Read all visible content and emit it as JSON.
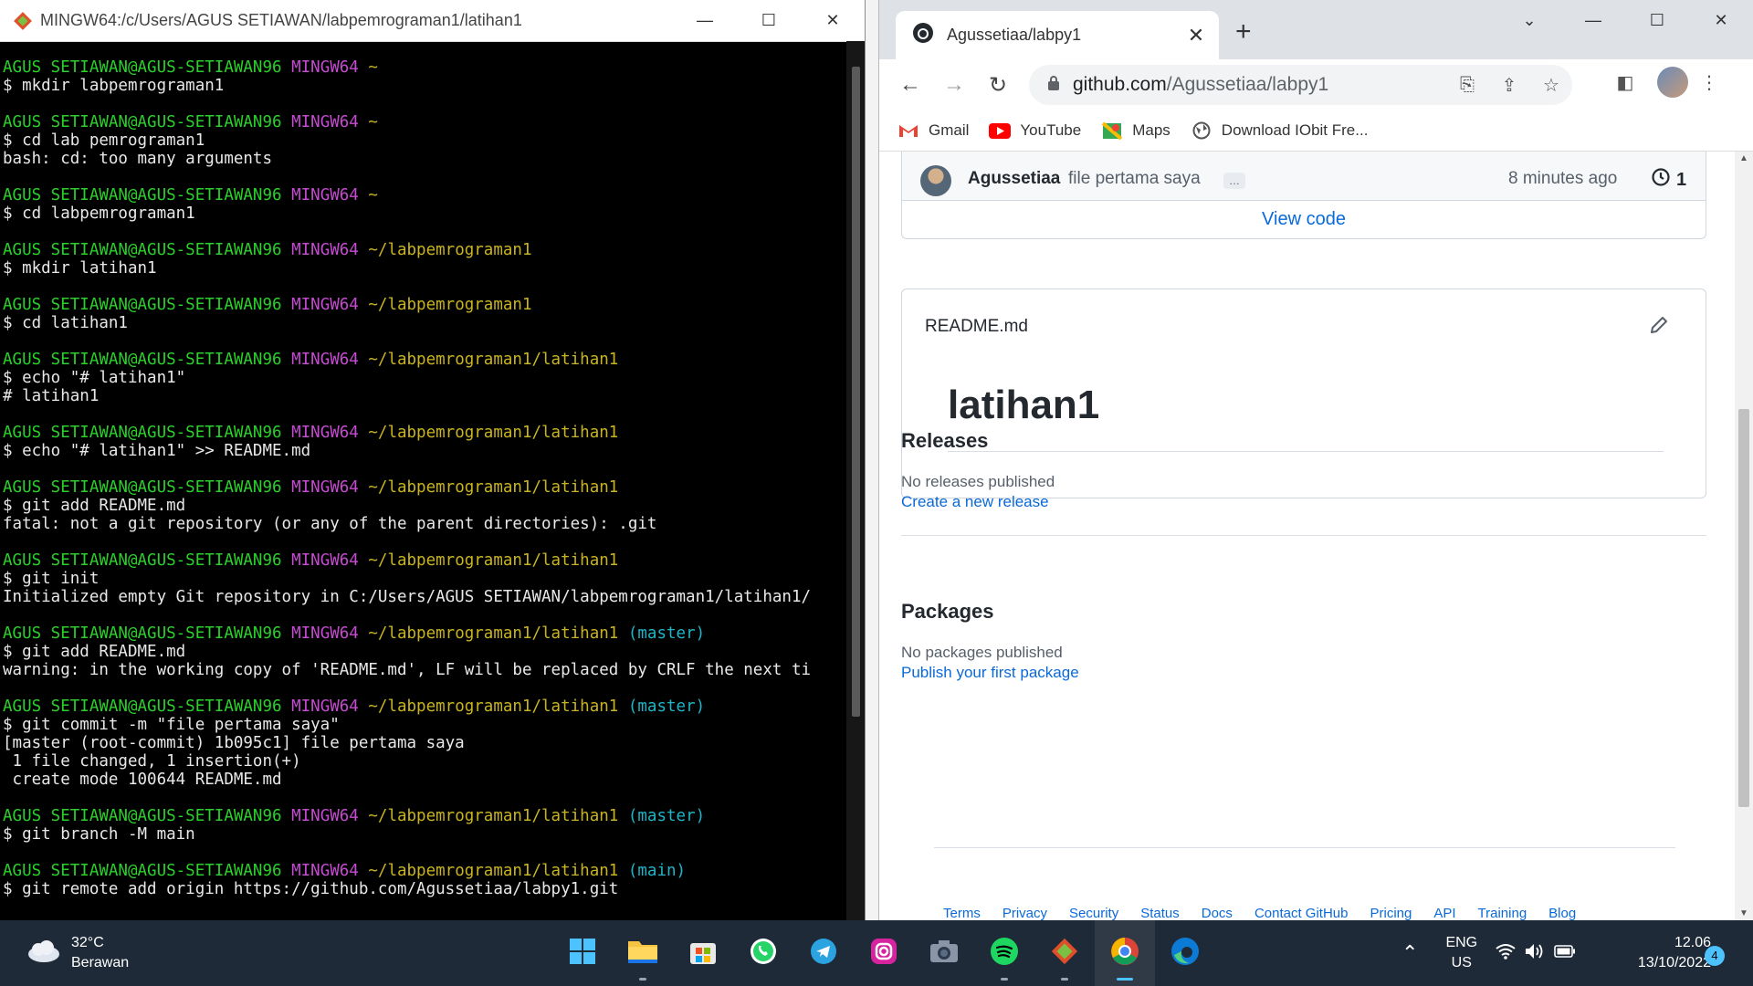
{
  "terminal": {
    "title": "MINGW64:/c/Users/AGUS SETIAWAN/labpemrograman1/latihan1",
    "lines": [
      {
        "u": "AGUS SETIAWAN@AGUS-SETIAWAN96",
        "m": "MINGW64",
        "p": "~",
        "b": ""
      },
      {
        "t": "$ mkdir labpemrograman1"
      },
      {
        "t": ""
      },
      {
        "u": "AGUS SETIAWAN@AGUS-SETIAWAN96",
        "m": "MINGW64",
        "p": "~",
        "b": ""
      },
      {
        "t": "$ cd lab pemrograman1"
      },
      {
        "t": "bash: cd: too many arguments"
      },
      {
        "t": ""
      },
      {
        "u": "AGUS SETIAWAN@AGUS-SETIAWAN96",
        "m": "MINGW64",
        "p": "~",
        "b": ""
      },
      {
        "t": "$ cd labpemrograman1"
      },
      {
        "t": ""
      },
      {
        "u": "AGUS SETIAWAN@AGUS-SETIAWAN96",
        "m": "MINGW64",
        "p": "~/labpemrograman1",
        "b": ""
      },
      {
        "t": "$ mkdir latihan1"
      },
      {
        "t": ""
      },
      {
        "u": "AGUS SETIAWAN@AGUS-SETIAWAN96",
        "m": "MINGW64",
        "p": "~/labpemrograman1",
        "b": ""
      },
      {
        "t": "$ cd latihan1"
      },
      {
        "t": ""
      },
      {
        "u": "AGUS SETIAWAN@AGUS-SETIAWAN96",
        "m": "MINGW64",
        "p": "~/labpemrograman1/latihan1",
        "b": ""
      },
      {
        "t": "$ echo \"# latihan1\""
      },
      {
        "t": "# latihan1"
      },
      {
        "t": ""
      },
      {
        "u": "AGUS SETIAWAN@AGUS-SETIAWAN96",
        "m": "MINGW64",
        "p": "~/labpemrograman1/latihan1",
        "b": ""
      },
      {
        "t": "$ echo \"# latihan1\" >> README.md"
      },
      {
        "t": ""
      },
      {
        "u": "AGUS SETIAWAN@AGUS-SETIAWAN96",
        "m": "MINGW64",
        "p": "~/labpemrograman1/latihan1",
        "b": ""
      },
      {
        "t": "$ git add README.md"
      },
      {
        "t": "fatal: not a git repository (or any of the parent directories): .git"
      },
      {
        "t": ""
      },
      {
        "u": "AGUS SETIAWAN@AGUS-SETIAWAN96",
        "m": "MINGW64",
        "p": "~/labpemrograman1/latihan1",
        "b": ""
      },
      {
        "t": "$ git init"
      },
      {
        "t": "Initialized empty Git repository in C:/Users/AGUS SETIAWAN/labpemrograman1/latihan1/"
      },
      {
        "t": ""
      },
      {
        "u": "AGUS SETIAWAN@AGUS-SETIAWAN96",
        "m": "MINGW64",
        "p": "~/labpemrograman1/latihan1",
        "b": "(master)"
      },
      {
        "t": "$ git add README.md"
      },
      {
        "t": "warning: in the working copy of 'README.md', LF will be replaced by CRLF the next ti"
      },
      {
        "t": ""
      },
      {
        "u": "AGUS SETIAWAN@AGUS-SETIAWAN96",
        "m": "MINGW64",
        "p": "~/labpemrograman1/latihan1",
        "b": "(master)"
      },
      {
        "t": "$ git commit -m \"file pertama saya\""
      },
      {
        "t": "[master (root-commit) 1b095c1] file pertama saya"
      },
      {
        "t": " 1 file changed, 1 insertion(+)"
      },
      {
        "t": " create mode 100644 README.md"
      },
      {
        "t": ""
      },
      {
        "u": "AGUS SETIAWAN@AGUS-SETIAWAN96",
        "m": "MINGW64",
        "p": "~/labpemrograman1/latihan1",
        "b": "(master)"
      },
      {
        "t": "$ git branch -M main"
      },
      {
        "t": ""
      },
      {
        "u": "AGUS SETIAWAN@AGUS-SETIAWAN96",
        "m": "MINGW64",
        "p": "~/labpemrograman1/latihan1",
        "b": "(main)"
      },
      {
        "t": "$ git remote add origin https://github.com/Agussetiaa/labpy1.git"
      }
    ]
  },
  "browser": {
    "tab_title": "Agussetiaa/labpy1",
    "url_host": "github.com",
    "url_path": "/Agussetiaa/labpy1",
    "bookmarks": [
      "Gmail",
      "YouTube",
      "Maps",
      "Download IObit Fre..."
    ],
    "commit": {
      "user": "Agussetiaa",
      "message": "file pertama saya",
      "more": "…",
      "time": "8 minutes ago",
      "count": "1"
    },
    "view_code": "View code",
    "readme": {
      "filename": "README.md",
      "heading": "latihan1"
    },
    "releases": {
      "title": "Releases",
      "empty": "No releases published",
      "link": "Create a new release"
    },
    "packages": {
      "title": "Packages",
      "empty": "No packages published",
      "link": "Publish your first package"
    },
    "footer_links": [
      "Terms",
      "Privacy",
      "Security",
      "Status",
      "Docs",
      "Contact GitHub",
      "Pricing",
      "API",
      "Training",
      "Blog"
    ]
  },
  "taskbar": {
    "temperature": "32°C",
    "weather": "Berawan",
    "lang_top": "ENG",
    "lang_bottom": "US",
    "time": "12.06",
    "date": "13/10/2022",
    "notifications": "4"
  }
}
